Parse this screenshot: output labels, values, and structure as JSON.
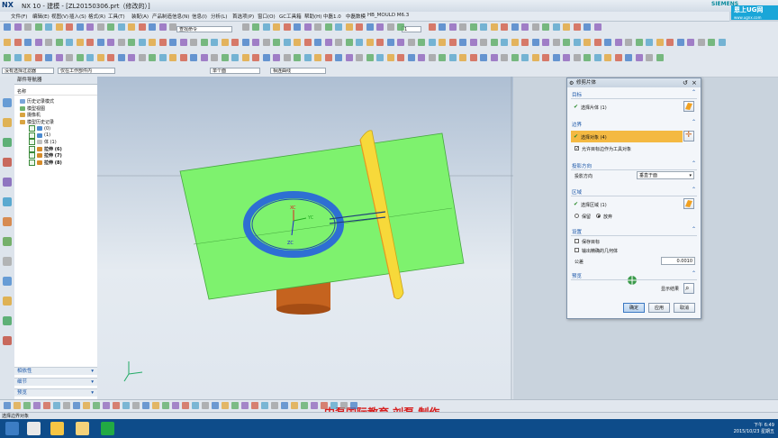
{
  "app": {
    "logo": "NX",
    "title": "NX 10 - 建模 - [ZL20150306.prt（修改的）]",
    "vendor": "SIEMENS",
    "badge": "恩上UG网",
    "badge_url": "www.ugnx.com"
  },
  "menu": [
    "文件(F)",
    "编辑(E)",
    "视图(V)",
    "插入(S)",
    "格式(R)",
    "工具(T)",
    "装配(A)",
    "产品制造信息(N)",
    "信息(I)",
    "分析(L)",
    "首选项(P)",
    "窗口(O)",
    "GC工具箱",
    "帮助(H)",
    "中磊1.0",
    "中磊数模",
    "HB_MOULD M6.3"
  ],
  "toolbar": {
    "search_placeholder": "查找命令",
    "layer_value": "1",
    "filter_value": "没有选择过滤器",
    "assembly_scope": "仅在工作部件内",
    "face_rule": "单个面",
    "curve_rule": "相连曲线"
  },
  "navigator": {
    "title": "部件导航器",
    "column_header": "名称",
    "nodes": [
      {
        "label": "历史记录模式",
        "level": 1
      },
      {
        "label": "模型视图",
        "level": 1
      },
      {
        "label": "摄像机",
        "level": 1
      },
      {
        "label": "模型历史记录",
        "level": 1
      },
      {
        "label": "(0)",
        "level": 2
      },
      {
        "label": "(1)",
        "level": 2
      },
      {
        "label": "体 (1)",
        "level": 2
      },
      {
        "label": "拉伸 (6)",
        "level": 2
      },
      {
        "label": "拉伸 (7)",
        "level": 2
      },
      {
        "label": "拉伸 (8)",
        "level": 2
      }
    ],
    "sections": [
      "相依性",
      "细节",
      "预览"
    ]
  },
  "viewport": {
    "axis_labels": [
      "XC",
      "YC",
      "ZC"
    ]
  },
  "dialog": {
    "title": "修剪片体",
    "sections": {
      "target": {
        "title": "目标",
        "row": "选择片体 (1)"
      },
      "boundary": {
        "title": "边界",
        "row": "选择对象 (4)",
        "checkbox": "允许目标边作为工具对象"
      },
      "projection": {
        "title": "投影方向",
        "label": "投影方向",
        "value": "垂直于面"
      },
      "region": {
        "title": "区域",
        "row": "选择区域 (1)",
        "keep": "保留",
        "discard": "放弃"
      },
      "settings": {
        "title": "设置",
        "keep_tool": "保存目标",
        "output_exact": "输出精确的几何体",
        "tolerance_label": "公差",
        "tolerance_value": "0.0010"
      },
      "preview": {
        "title": "预览",
        "show_result": "显示结果"
      }
    },
    "buttons": {
      "ok": "确定",
      "apply": "应用",
      "cancel": "取消"
    }
  },
  "status": {
    "cue": "选择边界对象"
  },
  "watermark": "中磊国际教育  刘磊  制作",
  "taskbar": {
    "time": "下午 6:49",
    "date": "2015/10/23 星期五"
  },
  "colors": {
    "sheet_green": "#7ef26e",
    "tool_face": "#f7d93a",
    "ring_blue": "#2e6fd3",
    "cylinder": "#c5631f",
    "highlight_orange": "#f4b942"
  }
}
